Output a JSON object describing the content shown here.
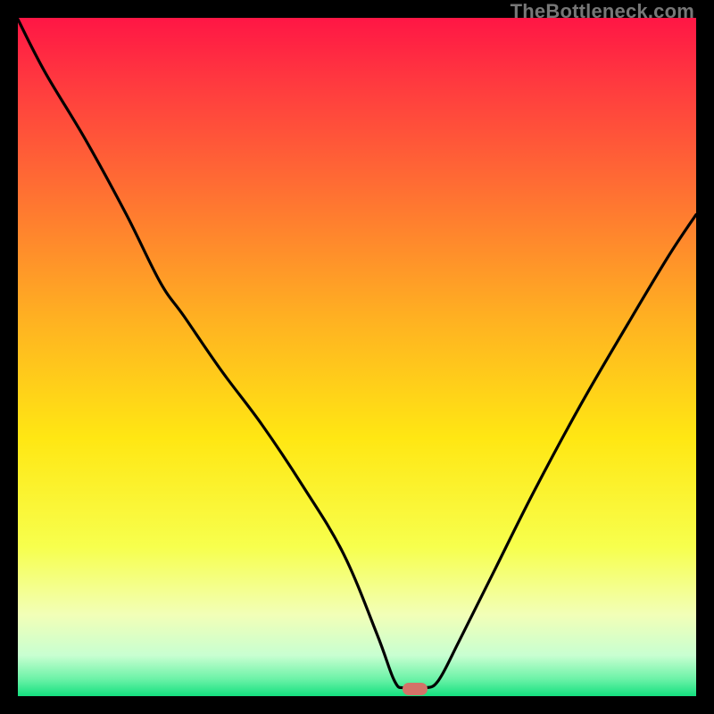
{
  "watermark": {
    "text": "TheBottleneck.com"
  },
  "chart_data": {
    "type": "line",
    "title": "",
    "xlabel": "",
    "ylabel": "",
    "xlim": [
      0,
      100
    ],
    "ylim": [
      0,
      100
    ],
    "grid": false,
    "legend": false,
    "background_gradient": {
      "stops": [
        {
          "pos": 0.0,
          "color": "#ff1645"
        },
        {
          "pos": 0.1,
          "color": "#ff3b3f"
        },
        {
          "pos": 0.25,
          "color": "#ff6e33"
        },
        {
          "pos": 0.45,
          "color": "#ffb321"
        },
        {
          "pos": 0.62,
          "color": "#ffe713"
        },
        {
          "pos": 0.78,
          "color": "#f7ff4d"
        },
        {
          "pos": 0.88,
          "color": "#f2ffb7"
        },
        {
          "pos": 0.94,
          "color": "#c8ffd1"
        },
        {
          "pos": 0.975,
          "color": "#6bf2a7"
        },
        {
          "pos": 1.0,
          "color": "#14e07f"
        }
      ]
    },
    "series": [
      {
        "name": "bottleneck-curve",
        "x": [
          0,
          4,
          10,
          16,
          21,
          24.5,
          30,
          36,
          42,
          48,
          53,
          55.5,
          57,
          60,
          62,
          65,
          70,
          76,
          83,
          90,
          96,
          100
        ],
        "y": [
          99.8,
          92,
          82,
          71,
          61,
          56,
          48,
          40,
          31,
          21,
          9,
          2.3,
          1.2,
          1.2,
          2.3,
          8,
          18,
          30,
          43,
          55,
          65,
          71
        ]
      }
    ],
    "marker": {
      "x": 58.5,
      "y": 1.0,
      "color": "#d37268"
    }
  }
}
